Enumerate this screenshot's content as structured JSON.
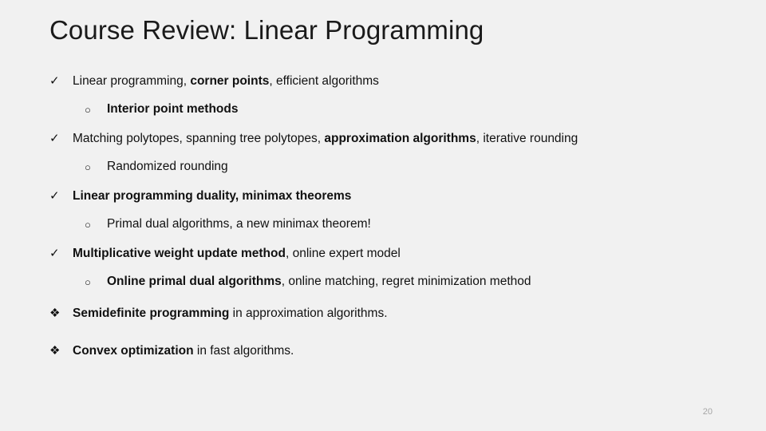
{
  "slide": {
    "title": "Course Review: Linear Programming",
    "page_number": "20",
    "markers": {
      "check": "✓",
      "circle": "○",
      "diamond": "❖"
    },
    "bullets": [
      {
        "level": 1,
        "marker": "check",
        "runs": [
          {
            "text": "Linear programming, ",
            "bold": false
          },
          {
            "text": "corner points",
            "bold": true
          },
          {
            "text": ", efficient algorithms",
            "bold": false
          }
        ]
      },
      {
        "level": 2,
        "marker": "circle",
        "runs": [
          {
            "text": "Interior point methods",
            "bold": true
          }
        ]
      },
      {
        "level": 1,
        "marker": "check",
        "runs": [
          {
            "text": "Matching polytopes, spanning tree polytopes, ",
            "bold": false
          },
          {
            "text": "approximation algorithms",
            "bold": true
          },
          {
            "text": ", iterative rounding",
            "bold": false
          }
        ]
      },
      {
        "level": 2,
        "marker": "circle",
        "runs": [
          {
            "text": "Randomized rounding",
            "bold": false
          }
        ]
      },
      {
        "level": 1,
        "marker": "check",
        "runs": [
          {
            "text": "Linear programming duality, minimax theorems",
            "bold": true
          }
        ]
      },
      {
        "level": 2,
        "marker": "circle",
        "runs": [
          {
            "text": "Primal dual algorithms, a new minimax theorem!",
            "bold": false
          }
        ]
      },
      {
        "level": 1,
        "marker": "check",
        "runs": [
          {
            "text": "Multiplicative weight update method",
            "bold": true
          },
          {
            "text": ", online expert model",
            "bold": false
          }
        ]
      },
      {
        "level": 2,
        "marker": "circle",
        "runs": [
          {
            "text": "Online primal dual algorithms",
            "bold": true
          },
          {
            "text": ", online matching, regret minimization method",
            "bold": false
          }
        ]
      },
      {
        "level": 1,
        "marker": "diamond",
        "extra_gap": true,
        "runs": [
          {
            "text": "Semidefinite programming",
            "bold": true
          },
          {
            "text": " in approximation algorithms.",
            "bold": false
          }
        ]
      },
      {
        "level": 1,
        "marker": "diamond",
        "runs": [
          {
            "text": "Convex optimization",
            "bold": true
          },
          {
            "text": " in fast algorithms.",
            "bold": false
          }
        ]
      }
    ]
  },
  "colors": {
    "background": "#f1f1f1",
    "text": "#111111",
    "title": "#1a1a1a",
    "page_number": "#a6a6a6"
  }
}
